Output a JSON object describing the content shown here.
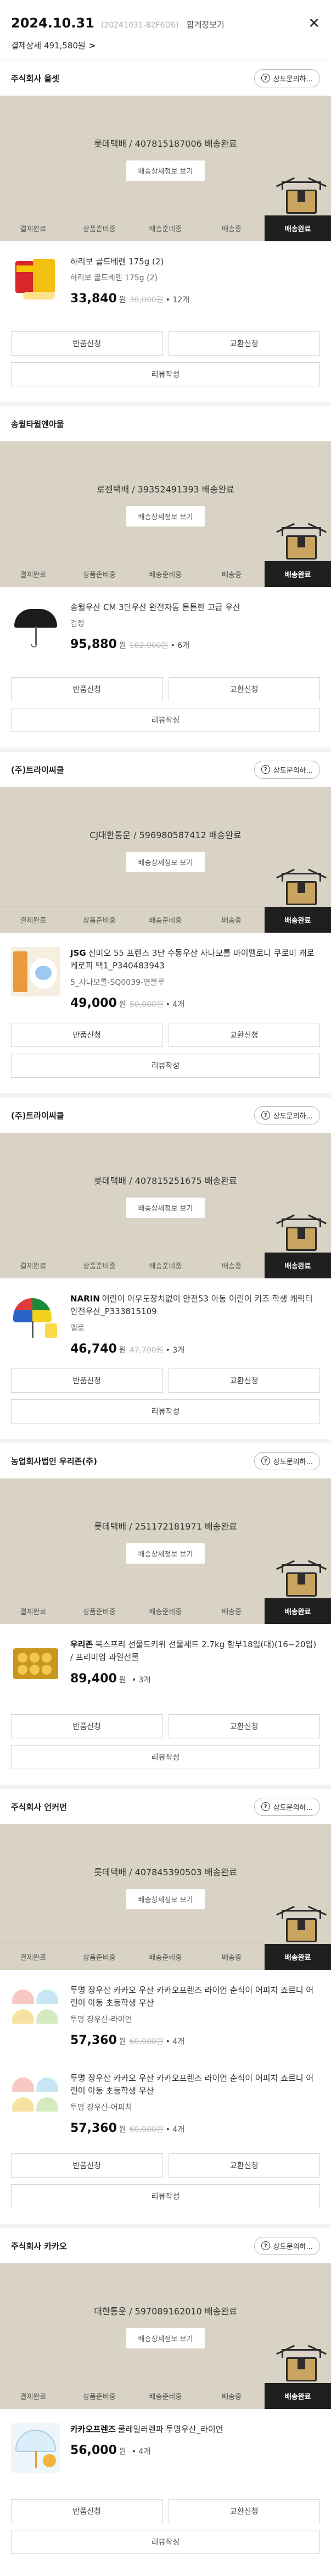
{
  "header": {
    "date": "2024.10.31",
    "order_id": "(20241031-82F6D6)",
    "merged_label": "합계정보기",
    "summary": "결제상세 491,580원",
    "summary_chev": ">",
    "close_icon": "close-icon"
  },
  "common": {
    "inquiry_label": "상도문의하...",
    "track_button": "배송상세정보 보기",
    "steps": [
      "결제완료",
      "상품준비중",
      "배송준비중",
      "배송중",
      "배송완료"
    ],
    "active_step": 4,
    "return_label": "반품신청",
    "exchange_label": "교환신청",
    "review_label": "리뷰작성",
    "won": "원",
    "accent_color": "#1f1f1f",
    "tracking_bg": "#d9d3c5"
  },
  "orders": [
    {
      "seller": "주식회사 올셋",
      "tracking": "롯데택배 / 407815187006 배송완료",
      "product": {
        "brand": "",
        "name": "하리보 골드베렌 175g (2)",
        "option": "하리보 골드베렌 175g (2)",
        "price": "33,840",
        "original": "36,000원",
        "qty": "• 12개"
      }
    },
    {
      "seller": "송월타월엔아울",
      "tracking": "로젠택배 / 39352491393 배송완료",
      "product": {
        "brand": "송월우산",
        "name": "송월우산 CM 3단우산 완전자동 튼튼한 고급 우산",
        "option": "검정",
        "price": "95,880",
        "original": "102,900원",
        "qty": "• 6개"
      }
    },
    {
      "seller": "(주)트라이씨클",
      "tracking": "CJ대한통운 / 596980587412 배송완료",
      "product": {
        "brand": "JSG",
        "name": "신미오 55 프렌즈 3단 수동우산 사나모롤 마이멜로디 쿠로미 캐로케로피 택1_P340483943",
        "option": "5_사나모롤-SQ0039-연블루",
        "price": "49,000",
        "original": "50,000원",
        "qty": "• 4개"
      }
    },
    {
      "seller": "(주)트라이씨클",
      "tracking": "롯데택배 / 407815251675 배송완료",
      "product": {
        "brand": "NARIN",
        "name": "어린이 아우도장치없이 안전53 아동 어린이 키즈 학생 캐릭터 안전우산_P333815109",
        "option": "옐로",
        "price": "46,740",
        "original": "47,700원",
        "qty": "• 3개"
      }
    },
    {
      "seller": "농업회사법인 우리존(주)",
      "tracking": "롯데택배 / 251172181971 배송완료",
      "product": {
        "brand": "우리존",
        "name": "복스프리 선물드키위 선물세트 2.7kg 함부18입(대)(16~20입) / 프리미엄 과일선물",
        "option": "",
        "price": "89,400",
        "original": "",
        "qty": "• 3개"
      }
    },
    {
      "seller": "주식회사 언커먼",
      "tracking": "롯데택배 / 407845390503 배송완료",
      "products": [
        {
          "name": "투명 장우산 카카오 우산 카카오프렌즈 라이언 춘식이 어피치 죠르디 어린이 아동 초등학생 우산",
          "option": "투명 장우산-라이언",
          "price": "57,360",
          "original": "60,000원",
          "qty": "• 4개"
        },
        {
          "name": "투명 장우산 카카오 우산 카카오프렌즈 라이언 춘식이 어피치 죠르디 어린이 아동 초등학생 우산",
          "option": "투명 장우산-어피치",
          "price": "57,360",
          "original": "60,000원",
          "qty": "• 4개"
        }
      ]
    },
    {
      "seller": "주식회사 카카오",
      "tracking": "대한통운 / 597089162010 배송완료",
      "product": {
        "brand": "카카오프렌즈",
        "name": "쿨레일러렌파 투명우산_라이언",
        "option": "",
        "price": "56,000",
        "original": "",
        "qty": "• 4개"
      }
    }
  ]
}
